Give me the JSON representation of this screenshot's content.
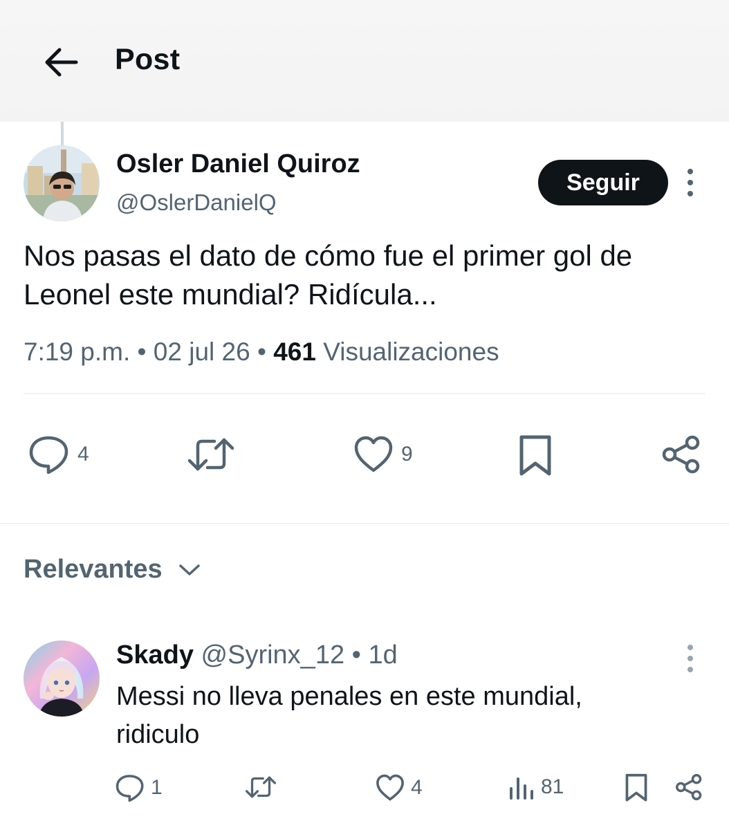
{
  "header": {
    "title": "Post",
    "back_icon": "arrow-left-icon"
  },
  "post": {
    "author_name": "Osler Daniel Quiroz",
    "author_handle": "@OslerDanielQ",
    "follow_label": "Seguir",
    "text": "Nos pasas el dato de cómo fue el primer gol de Leonel este mundial? Ridícula...",
    "time": "7:19 p.m.",
    "sep1": "•",
    "date": "02 jul 26",
    "sep2": "•",
    "views_count": "461",
    "views_label": "Visualizaciones",
    "actions": {
      "replies": "4",
      "likes": "9"
    }
  },
  "sort": {
    "label": "Relevantes"
  },
  "reply": {
    "name": "Skady",
    "handle": "@Syrinx_12",
    "dot": "•",
    "time": "1d",
    "text": "Messi no lleva penales en este mundial, ridiculo",
    "actions": {
      "replies": "1",
      "likes": "4",
      "views": "81"
    }
  },
  "colors": {
    "primary_text": "#0f1419",
    "secondary_text": "#536471",
    "divider": "#eff3f4",
    "button_bg": "#0f1419"
  }
}
